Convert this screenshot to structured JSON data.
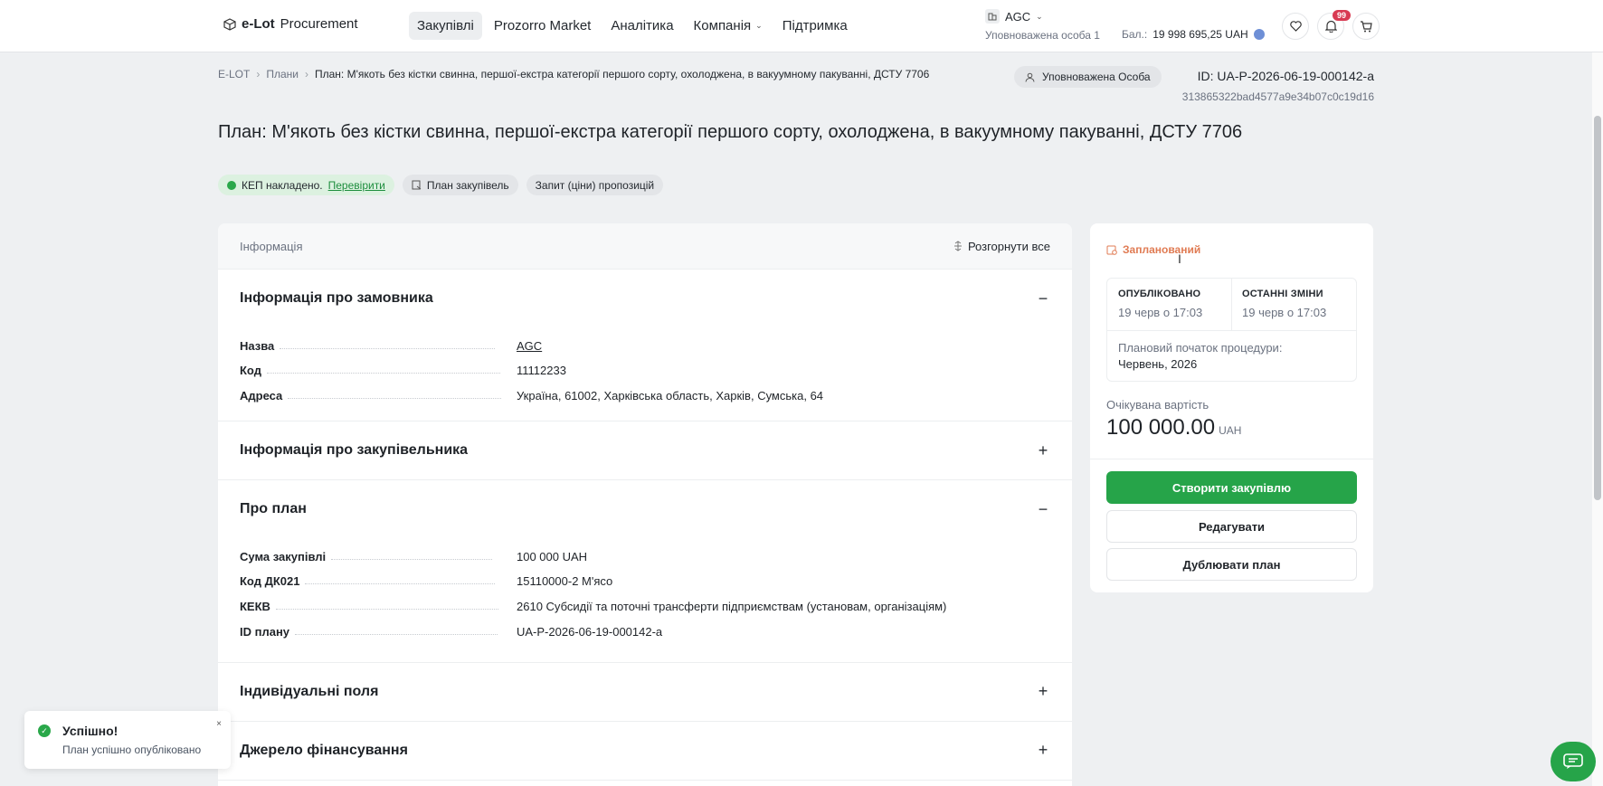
{
  "header": {
    "logo_bold": "e-Lot",
    "logo_rest": "Procurement",
    "nav": [
      "Закупівлі",
      "Prozorro Market",
      "Аналітика",
      "Компанія",
      "Підтримка"
    ],
    "org_name": "AGC",
    "org_role": "Уповноважена особа 1",
    "balance_label": "Бал.:",
    "balance_value": "19 998 695,25 UAH",
    "notifications_count": "99"
  },
  "breadcrumb": {
    "items": [
      "E-LOT",
      "Плани"
    ],
    "current": "План: М'якоть без кістки свинна, першої-екстра категорії першого сорту, охолоджена, в вакуумному пакуванні, ДСТУ 7706"
  },
  "auth_chip": "Уповноважена Особа",
  "plan_id": "ID: UA-P-2026-06-19-000142-a",
  "plan_hash": "313865322bad4577a9e34b07c0c19d16",
  "page_title": "План: М'якоть без кістки свинна, першої-екстра категорії першого сорту, охолоджена, в вакуумному пакуванні, ДСТУ 7706",
  "tags": {
    "kep": "КЕП накладено.",
    "kep_link": "Перевірити",
    "plan": "План закупівель",
    "request": "Запит (ціни) пропозицій"
  },
  "info": {
    "title": "Інформація",
    "expand_all": "Розгорнути все",
    "customer": {
      "title": "Інформація про замовника",
      "toggle": "−",
      "rows": [
        {
          "k": "Назва",
          "v": "AGC"
        },
        {
          "k": "Код",
          "v": "11112233"
        },
        {
          "k": "Адреса",
          "v": "Україна, 61002, Харківська область, Харків, Сумська, 64"
        }
      ]
    },
    "buyer": {
      "title": "Інформація про закупівельника",
      "toggle": "+"
    },
    "plan": {
      "title": "Про план",
      "toggle": "−",
      "rows": [
        {
          "k": "Сума закупівлі",
          "v": "100 000 UAH"
        },
        {
          "k": "Код ДК021",
          "v": "15110000-2 М'ясо"
        },
        {
          "k": "КЕКВ",
          "v": "2610 Субсидії та поточні трансферти підприємствам (установам, організаціям)"
        },
        {
          "k": "ID плану",
          "v": "UA-P-2026-06-19-000142-a"
        }
      ]
    },
    "custom": {
      "title": "Індивідуальні поля",
      "toggle": "+"
    },
    "funding": {
      "title": "Джерело фінансування",
      "toggle": "+"
    }
  },
  "side": {
    "status": "Запланований",
    "published_label": "ОПУБЛІКОВАНО",
    "published_value": "19 черв о 17:03",
    "changed_label": "ОСТАННІ ЗМІНИ",
    "changed_value": "19 черв о 17:03",
    "start_label": "Плановий початок процедури:",
    "start_value": "Червень, 2026",
    "expected_label": "Очікувана вартість",
    "expected_value": "100 000.00",
    "expected_currency": "UAH",
    "create_btn": "Створити закупівлю",
    "edit_btn": "Редагувати",
    "duplicate_btn": "Дублювати план"
  },
  "toast": {
    "title": "Успішно!",
    "text": "План успішно опубліковано",
    "close": "×"
  },
  "colors": {
    "primary_green": "#26a449",
    "status_orange": "#e07b53",
    "badge_red": "#d83a52"
  }
}
